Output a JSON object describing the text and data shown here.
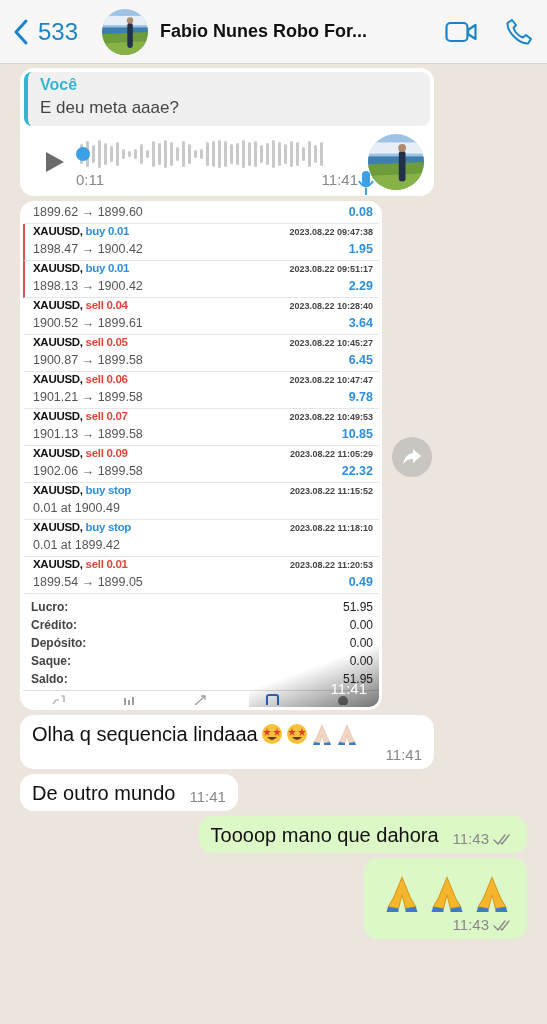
{
  "header": {
    "back_count": "533",
    "title": "Fabio Nunes Robo For..."
  },
  "messages": [
    {
      "kind": "audio",
      "outgoing": false,
      "quote": {
        "author": "Você",
        "text": "E deu meta aaae?"
      },
      "audio": {
        "duration": "0:11"
      },
      "time": "11:41"
    },
    {
      "outgoing": false,
      "time": "11:41",
      "trades_head": {
        "prices": "1899.62 → 1899.60",
        "profit": "0.08"
      },
      "trades": [
        {
          "symbol": "XAUUSD,",
          "sell": false,
          "order": "buy 0.01",
          "time": "2023.08.22 09:47:38",
          "detail": "1898.47 → 1900.42",
          "profit": "1.95",
          "marked": true
        },
        {
          "symbol": "XAUUSD,",
          "sell": false,
          "order": "buy 0.01",
          "time": "2023.08.22 09:51:17",
          "detail": "1898.13 → 1900.42",
          "profit": "2.29",
          "marked": true
        },
        {
          "symbol": "XAUUSD,",
          "sell": true,
          "order": "sell 0.04",
          "time": "2023.08.22 10:28:40",
          "detail": "1900.52 → 1899.61",
          "profit": "3.64",
          "marked": false
        },
        {
          "symbol": "XAUUSD,",
          "sell": true,
          "order": "sell 0.05",
          "time": "2023.08.22 10:45:27",
          "detail": "1900.87 → 1899.58",
          "profit": "6.45",
          "marked": false
        },
        {
          "symbol": "XAUUSD,",
          "sell": true,
          "order": "sell 0.06",
          "time": "2023.08.22 10:47:47",
          "detail": "1901.21 → 1899.58",
          "profit": "9.78",
          "marked": false
        },
        {
          "symbol": "XAUUSD,",
          "sell": true,
          "order": "sell 0.07",
          "time": "2023.08.22 10:49:53",
          "detail": "1901.13 → 1899.58",
          "profit": "10.85",
          "marked": false
        },
        {
          "symbol": "XAUUSD,",
          "sell": true,
          "order": "sell 0.09",
          "time": "2023.08.22 11:05:29",
          "detail": "1902.06 → 1899.58",
          "profit": "22.32",
          "marked": false
        },
        {
          "symbol": "XAUUSD,",
          "sell": false,
          "order": "buy stop",
          "time": "2023.08.22 11:15:52",
          "detail": "0.01 at 1900.49",
          "marked": false
        },
        {
          "symbol": "XAUUSD,",
          "sell": false,
          "order": "buy stop",
          "time": "2023.08.22 11:18:10",
          "detail": "0.01 at 1899.42",
          "marked": false
        },
        {
          "symbol": "XAUUSD,",
          "sell": true,
          "order": "sell 0.01",
          "time": "2023.08.22 11:20:53",
          "detail": "1899.54 → 1899.05",
          "profit": "0.49",
          "marked": false
        }
      ],
      "summary": [
        {
          "label": "Lucro:",
          "value": "51.95"
        },
        {
          "label": "Crédito:",
          "value": "0.00"
        },
        {
          "label": "Depósito:",
          "value": "0.00"
        },
        {
          "label": "Saque:",
          "value": "0.00"
        },
        {
          "label": "Saldo:",
          "value": "51.95"
        }
      ],
      "toolbar": [
        {
          "selected": false
        },
        {
          "selected": false
        },
        {
          "selected": false
        },
        {
          "selected": true
        },
        {
          "selected": false
        }
      ]
    },
    {
      "kind": "text",
      "outgoing": false,
      "text": "Olha q sequencia lindaaa",
      "emojis": [
        {
          "kind": "star_struck"
        },
        {
          "kind": "star_struck"
        },
        {
          "kind": "pray_light"
        },
        {
          "kind": "pray_light"
        }
      ],
      "time": "11:41"
    },
    {
      "kind": "text",
      "outgoing": false,
      "text": "De outro mundo",
      "time": "11:41"
    },
    {
      "kind": "text",
      "outgoing": true,
      "text": "Toooop mano que dahora",
      "time": "11:43",
      "read": false
    },
    {
      "kind": "text",
      "outgoing": true,
      "emojis": [
        {
          "kind": "pray"
        },
        {
          "kind": "pray"
        },
        {
          "kind": "pray"
        }
      ],
      "time": "11:43",
      "read": false
    }
  ]
}
